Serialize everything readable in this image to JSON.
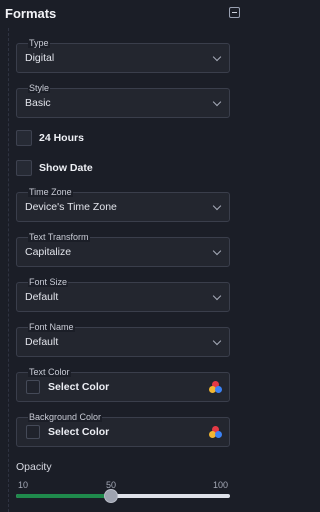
{
  "header": {
    "title": "Formats"
  },
  "fields": {
    "type": {
      "label": "Type",
      "value": "Digital"
    },
    "style": {
      "label": "Style",
      "value": "Basic"
    },
    "time_zone": {
      "label": "Time Zone",
      "value": "Device's Time Zone"
    },
    "text_transform": {
      "label": "Text Transform",
      "value": "Capitalize"
    },
    "font_size": {
      "label": "Font Size",
      "value": "Default"
    },
    "font_name": {
      "label": "Font Name",
      "value": "Default"
    }
  },
  "toggles": {
    "hours_24": {
      "label": "24 Hours",
      "checked": false
    },
    "show_date": {
      "label": "Show Date",
      "checked": false
    }
  },
  "colors": {
    "text_color": {
      "label": "Text Color",
      "button": "Select Color"
    },
    "background_color": {
      "label": "Background Color",
      "button": "Select Color"
    }
  },
  "opacity": {
    "label": "Opacity",
    "min_label": "10",
    "mid_label": "50",
    "max_label": "100",
    "min": 10,
    "max": 100,
    "value": 50,
    "fill_color": "#1f8a4c"
  },
  "palette_colors": [
    "#e53945",
    "#f2b632",
    "#3b82f6"
  ]
}
